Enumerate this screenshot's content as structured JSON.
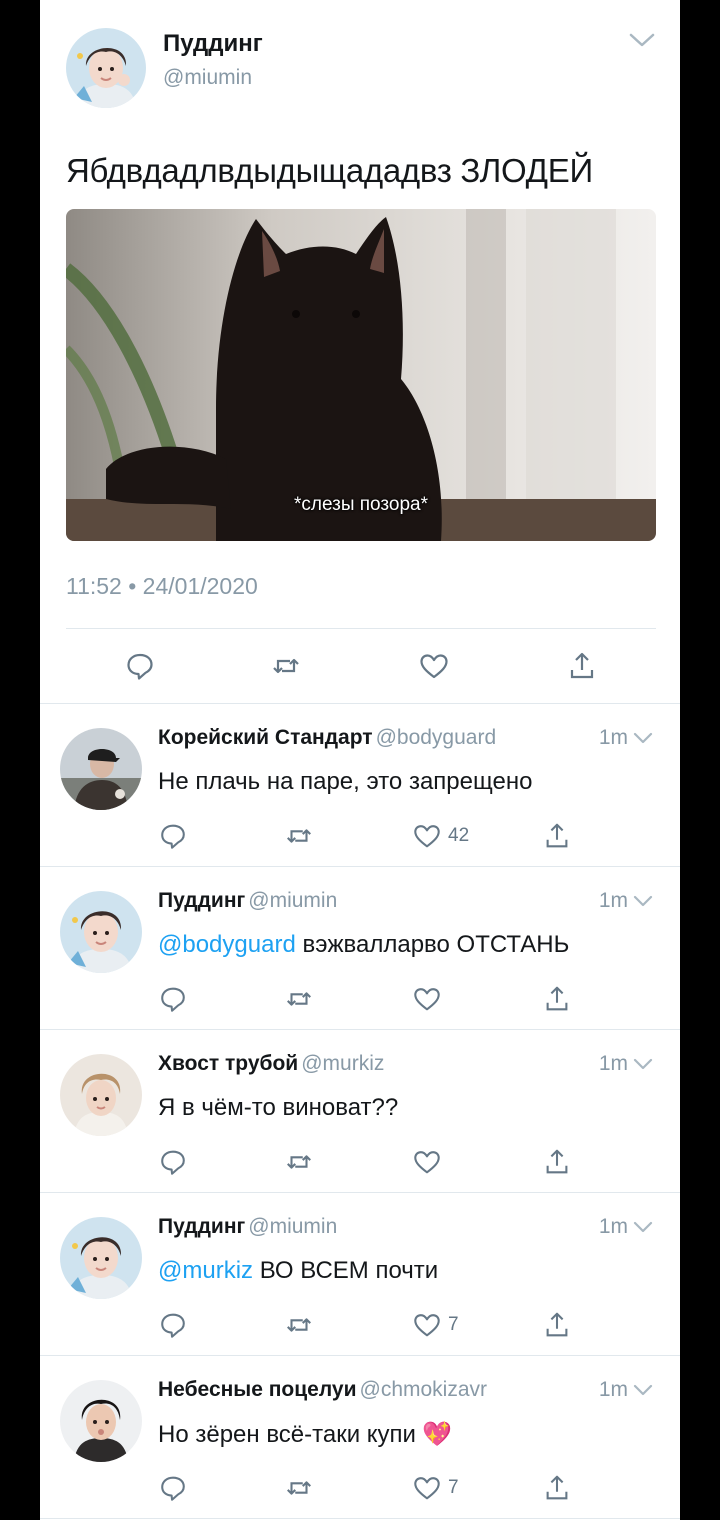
{
  "main_tweet": {
    "author_name": "Пуддинг",
    "author_handle": "@miumin",
    "text": "Ябдвдадлвдыдыщададвз ЗЛОДЕЙ",
    "media_caption": "*слезы позора*",
    "timestamp": "11:52 • 24/01/2020"
  },
  "replies": [
    {
      "name": "Корейский Стандарт",
      "handle": "@bodyguard",
      "time": "1m",
      "mention": "",
      "text": "Не плачь на паре, это запрещено",
      "emoji": "",
      "like_count": "42"
    },
    {
      "name": "Пуддинг",
      "handle": "@miumin",
      "time": "1m",
      "mention": "@bodyguard",
      "text": "вэжвалларво ОТСТАНЬ",
      "emoji": "",
      "like_count": ""
    },
    {
      "name": "Хвост трубой",
      "handle": "@murkiz",
      "time": "1m",
      "mention": "",
      "text": "Я в чём-то виноват??",
      "emoji": "",
      "like_count": ""
    },
    {
      "name": "Пуддинг",
      "handle": "@miumin",
      "time": "1m",
      "mention": "@murkiz",
      "text": "ВО ВСЕМ почти",
      "emoji": "",
      "like_count": "7"
    },
    {
      "name": "Небесные поцелуи",
      "handle": "@chmokizavr",
      "time": "1m",
      "mention": "",
      "text": "Но зёрен всё-таки купи",
      "emoji": "💖",
      "like_count": "7"
    }
  ],
  "icons": {
    "reply": "reply-icon",
    "retweet": "retweet-icon",
    "like": "heart-icon",
    "share": "share-icon",
    "menu": "chevron-down-icon"
  },
  "colors": {
    "accent": "#1da1f2",
    "secondary_text": "#8899a6",
    "icon": "#657786"
  }
}
